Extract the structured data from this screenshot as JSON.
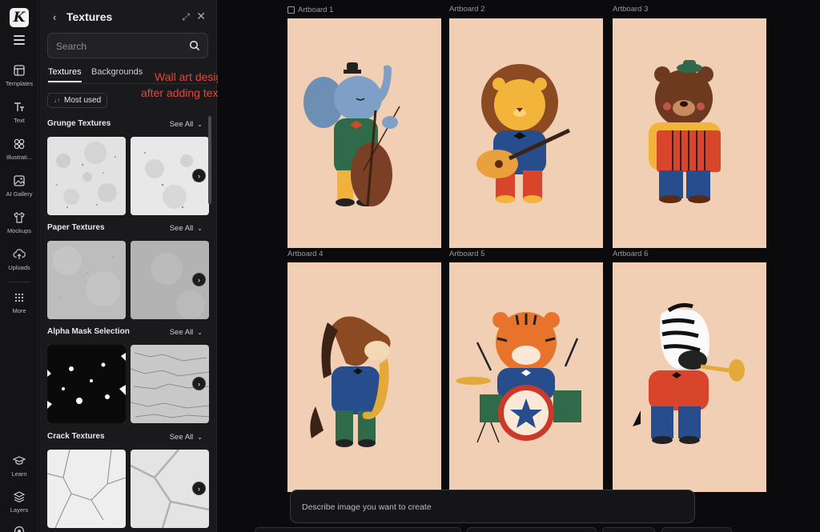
{
  "rail": {
    "logo": "K",
    "items": [
      {
        "label": "Templates",
        "icon": "template-icon"
      },
      {
        "label": "Text",
        "icon": "text-icon"
      },
      {
        "label": "Illustrati...",
        "icon": "illustrations-icon"
      },
      {
        "label": "AI Gallery",
        "icon": "ai-gallery-icon"
      },
      {
        "label": "Mockups",
        "icon": "tshirt-icon"
      },
      {
        "label": "Uploads",
        "icon": "upload-icon"
      },
      {
        "label": "More",
        "icon": "grid-dots-icon"
      },
      {
        "label": "Learn",
        "icon": "graduation-cap-icon"
      },
      {
        "label": "Layers",
        "icon": "layers-icon"
      }
    ]
  },
  "panel": {
    "title": "Textures",
    "search_placeholder": "Search",
    "tabs": [
      "Textures",
      "Backgrounds"
    ],
    "active_tab": "Textures",
    "filter_chip": "Most used",
    "see_all_label": "See All",
    "sections": [
      {
        "title": "Grunge Textures"
      },
      {
        "title": "Paper Textures"
      },
      {
        "title": "Alpha Mask Selection"
      },
      {
        "title": "Crack Textures"
      }
    ]
  },
  "annotation": {
    "line1": "Wall art designs",
    "line2": "after adding textures",
    "color": "#e2473a"
  },
  "canvas": {
    "artboards": [
      {
        "label": "Artboard 1",
        "subject": "elephant playing double bass"
      },
      {
        "label": "Artboard 2",
        "subject": "lion playing guitar"
      },
      {
        "label": "Artboard 3",
        "subject": "bear playing accordion"
      },
      {
        "label": "Artboard 4",
        "subject": "horse playing saxophone"
      },
      {
        "label": "Artboard 5",
        "subject": "tiger playing drums"
      },
      {
        "label": "Artboard 6",
        "subject": "zebra playing trumpet"
      }
    ],
    "artboard_bg": "#f1cfb4"
  },
  "prompt": {
    "placeholder": "Describe image you want to create"
  }
}
